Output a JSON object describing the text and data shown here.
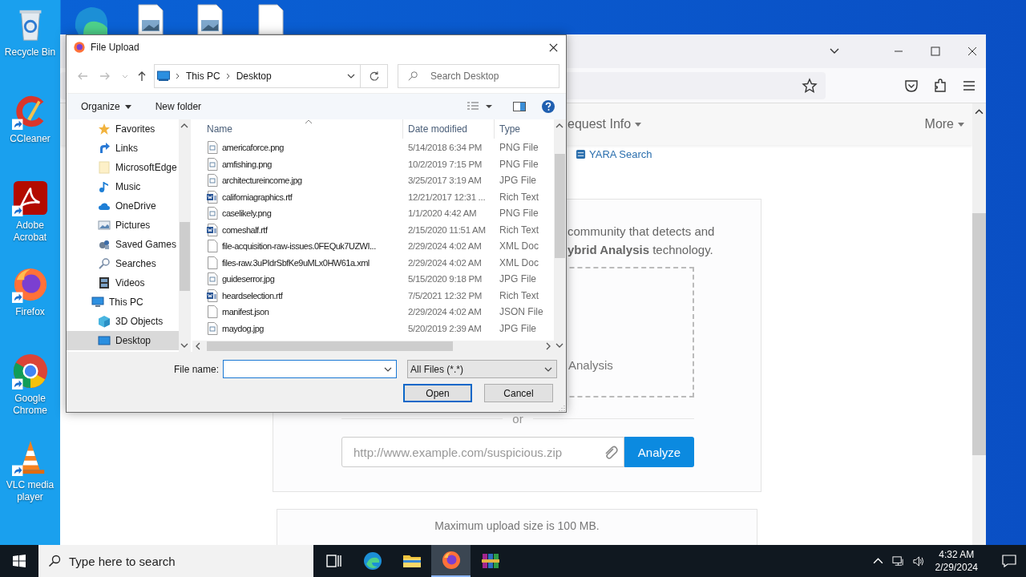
{
  "desktop": {
    "icons": [
      {
        "label": "Recycle Bin"
      },
      {
        "label": "CCleaner"
      },
      {
        "label": "Adobe Acrobat"
      },
      {
        "label": "Firefox"
      },
      {
        "label": "Google Chrome"
      },
      {
        "label": "VLC media player"
      }
    ]
  },
  "browser": {
    "nav": [
      {
        "label": "equest Info"
      },
      {
        "label": "More"
      }
    ],
    "link": "YARA Search",
    "intro": [
      "community that detects and",
      "**ybrid Analysis** technology."
    ],
    "drop_label": "Analysis",
    "separator": "or",
    "url_field": {
      "placeholder": "http://www.example.com/suspicious.zip"
    },
    "analyze_button": "Analyze",
    "limit_note": "Maximum upload size is 100 MB."
  },
  "dialog": {
    "title": "File Upload",
    "breadcrumb": [
      "This PC",
      "Desktop"
    ],
    "search": {
      "placeholder": "Search Desktop"
    },
    "toolbar": [
      "Organize",
      "New folder"
    ],
    "nav_tree": [
      {
        "children": [
          {
            "label": "Favorites",
            "selected": false
          },
          {
            "label": "Links",
            "selected": false
          },
          {
            "label": "MicrosoftEdge",
            "selected": false
          },
          {
            "label": "Music",
            "selected": false
          },
          {
            "label": "OneDrive",
            "selected": false
          },
          {
            "label": "Pictures",
            "selected": false
          },
          {
            "label": "Saved Games",
            "selected": false
          },
          {
            "label": "Searches",
            "selected": false
          },
          {
            "label": "Videos",
            "selected": false
          }
        ]
      },
      {
        "label": "This PC",
        "selected": false,
        "children": [
          {
            "label": "3D Objects",
            "selected": false
          },
          {
            "label": "Desktop",
            "selected": true
          }
        ]
      }
    ],
    "columns": [
      "Name",
      "Date modified",
      "Type"
    ],
    "files": [
      {
        "name": "americaforce.png",
        "date": "5/14/2018 6:34 PM",
        "type": "PNG File",
        "kind": "image"
      },
      {
        "name": "amfishing.png",
        "date": "10/2/2019 7:15 PM",
        "type": "PNG File",
        "kind": "image"
      },
      {
        "name": "architectureincome.jpg",
        "date": "3/25/2017 3:19 AM",
        "type": "JPG File",
        "kind": "image"
      },
      {
        "name": "californiagraphics.rtf",
        "date": "12/21/2017 12:31 ...",
        "type": "Rich Text",
        "kind": "document"
      },
      {
        "name": "caselikely.png",
        "date": "1/1/2020 4:42 AM",
        "type": "PNG File",
        "kind": "image"
      },
      {
        "name": "comeshalf.rtf",
        "date": "2/15/2020 11:51 AM",
        "type": "Rich Text",
        "kind": "document"
      },
      {
        "name": "file-acquisition-raw-issues.0FEQuk7UZWI...",
        "date": "2/29/2024 4:02 AM",
        "type": "XML Doc",
        "kind": "blank"
      },
      {
        "name": "files-raw.3uPIdrSbfKe9uMLx0HW61a.xml",
        "date": "2/29/2024 4:02 AM",
        "type": "XML Doc",
        "kind": "blank"
      },
      {
        "name": "guideserror.jpg",
        "date": "5/15/2020 9:18 PM",
        "type": "JPG File",
        "kind": "image"
      },
      {
        "name": "heardselection.rtf",
        "date": "7/5/2021 12:32 PM",
        "type": "Rich Text",
        "kind": "document"
      },
      {
        "name": "manifest.json",
        "date": "2/29/2024 4:02 AM",
        "type": "JSON File",
        "kind": "blank"
      },
      {
        "name": "maydog.jpg",
        "date": "5/20/2019 2:39 AM",
        "type": "JPG File",
        "kind": "image"
      }
    ],
    "file_name_label": "File name:",
    "filter": "All Files (*.*)",
    "buttons": [
      {
        "label": "Open",
        "default": true
      },
      {
        "label": "Cancel",
        "default": false
      }
    ]
  },
  "taskbar": {
    "search_placeholder": "Type here to search",
    "apps": [
      {
        "active": false
      },
      {
        "active": false
      },
      {
        "active": true
      },
      {
        "active": false
      }
    ],
    "time": "4:32 AM",
    "date": "2/29/2024"
  }
}
